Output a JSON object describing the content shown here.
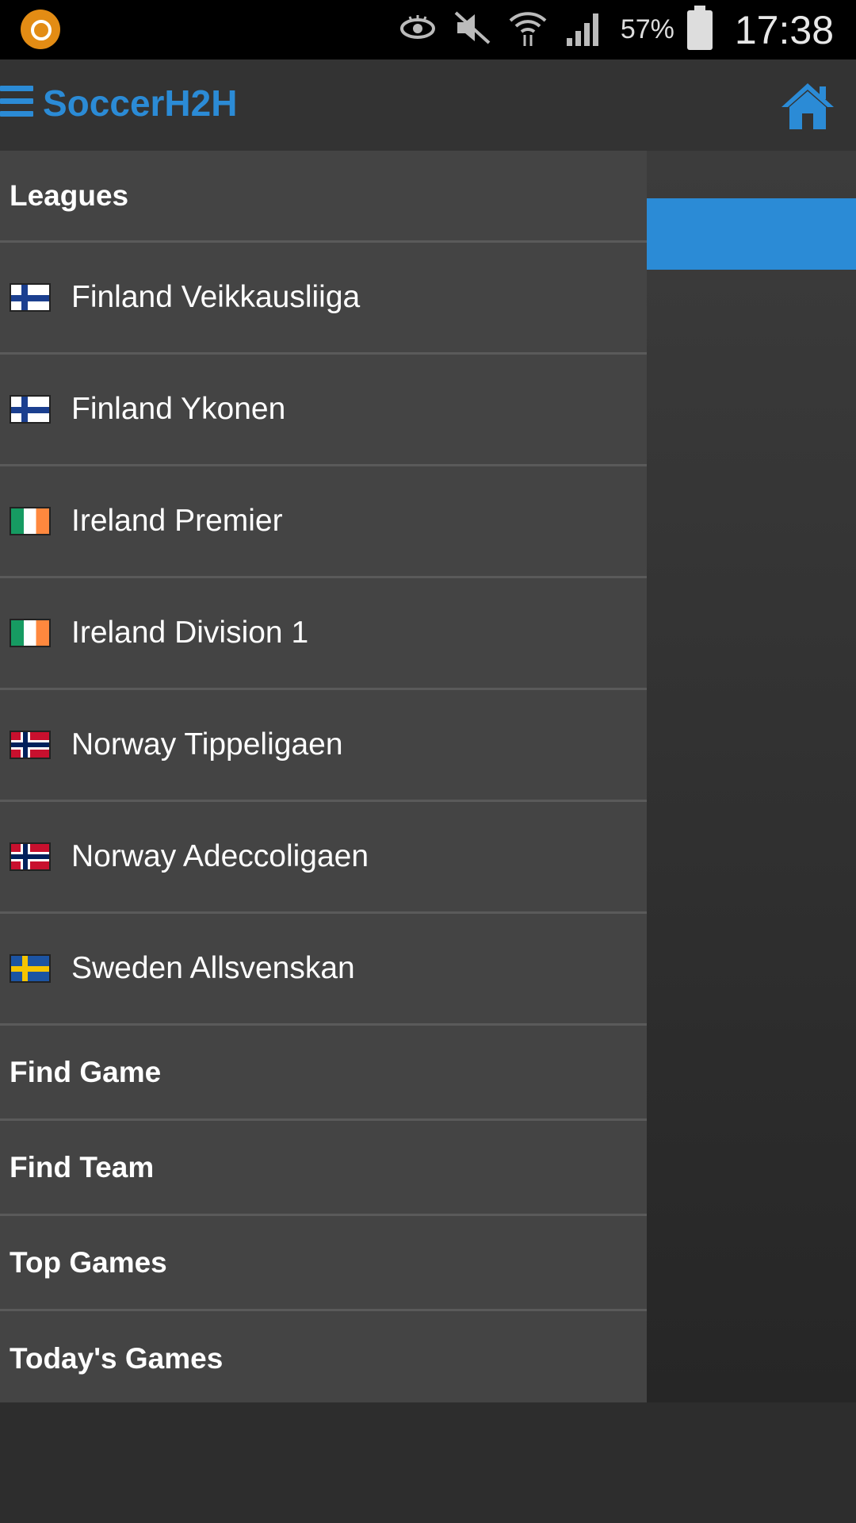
{
  "status_bar": {
    "battery": "57%",
    "time": "17:38",
    "icons": [
      "app-notification-icon",
      "eye-icon",
      "mute-icon",
      "wifi-icon",
      "signal-icon",
      "battery-icon"
    ]
  },
  "action_bar": {
    "title": "SoccerH2H",
    "menu_icon": "hamburger-menu-icon",
    "home_icon": "home-icon",
    "accent_color": "#2b8bd6"
  },
  "drawer": {
    "section_header": "Leagues",
    "leagues": [
      {
        "label": "Finland Veikkausliiga",
        "flag": "finland-flag-icon"
      },
      {
        "label": "Finland Ykonen",
        "flag": "finland-flag-icon"
      },
      {
        "label": "Ireland Premier",
        "flag": "ireland-flag-icon"
      },
      {
        "label": "Ireland Division 1",
        "flag": "ireland-flag-icon"
      },
      {
        "label": "Norway Tippeligaen",
        "flag": "norway-flag-icon"
      },
      {
        "label": "Norway Adeccoligaen",
        "flag": "norway-flag-icon"
      },
      {
        "label": "Sweden Allsvenskan",
        "flag": "sweden-flag-icon"
      }
    ],
    "nav_items": [
      {
        "label": "Find Game"
      },
      {
        "label": "Find Team"
      },
      {
        "label": "Top Games"
      },
      {
        "label": "Today's Games"
      }
    ]
  }
}
